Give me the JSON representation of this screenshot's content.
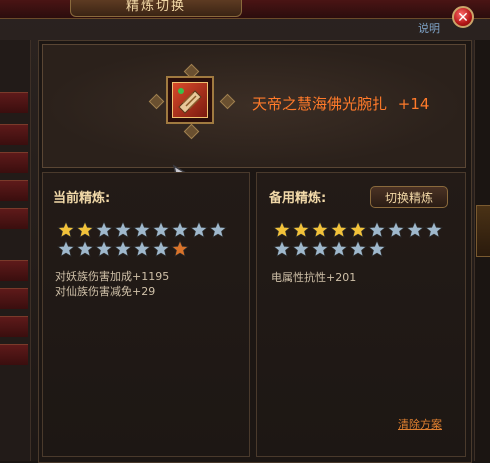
{
  "window": {
    "title": "精炼切换",
    "help_link": "说明",
    "close_icon": "close-icon"
  },
  "item": {
    "name": "天帝之慧海佛光腕扎",
    "enhance": "+14",
    "icon": "bracer-icon"
  },
  "current_refine": {
    "title": "当前精炼:",
    "stars": [
      "gold",
      "gold",
      "silver",
      "silver",
      "silver",
      "silver",
      "silver",
      "silver",
      "silver",
      "silver",
      "silver",
      "silver",
      "silver",
      "silver",
      "silver",
      "bronze"
    ],
    "effects": [
      "对妖族伤害加成+1195",
      "对仙族伤害减免+29"
    ]
  },
  "backup_refine": {
    "title": "备用精炼:",
    "switch_button": "切换精炼",
    "stars": [
      "gold",
      "gold",
      "gold",
      "gold",
      "gold",
      "silver",
      "silver",
      "silver",
      "silver",
      "silver",
      "silver",
      "silver",
      "silver",
      "silver",
      "silver"
    ],
    "effects": [
      "电属性抗性+201"
    ],
    "clear_link": "清除方案"
  },
  "colors": {
    "item_name": "#ff7a2a",
    "star_gold": "#f2c23a",
    "star_silver": "#9fb8cc",
    "star_bronze": "#d9732a",
    "link_orange": "#e08030"
  }
}
